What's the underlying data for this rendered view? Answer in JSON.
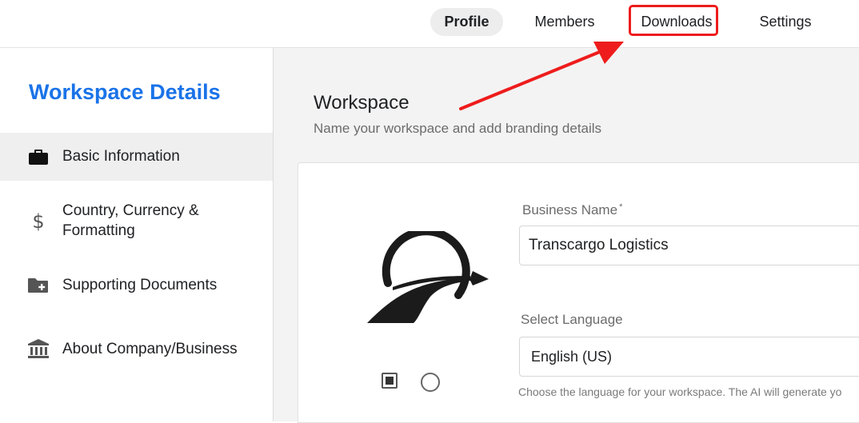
{
  "header": {
    "tabs": [
      {
        "label": "Profile",
        "active": true
      },
      {
        "label": "Members",
        "active": false
      },
      {
        "label": "Downloads",
        "active": false,
        "highlighted": true
      },
      {
        "label": "Settings",
        "active": false
      }
    ]
  },
  "annotation": {
    "color": "#ee1c1c",
    "target": "Downloads"
  },
  "sidebar": {
    "title": "Workspace Details",
    "items": [
      {
        "label": "Basic Information",
        "icon": "briefcase-icon",
        "active": true
      },
      {
        "label_line1": "Country, Currency &",
        "label_line2": "Formatting",
        "icon": "dollar-icon",
        "active": false
      },
      {
        "label": "Supporting Documents",
        "icon": "folder-plus-icon",
        "active": false
      },
      {
        "label": "About Company/Business",
        "icon": "bank-icon",
        "active": false
      }
    ]
  },
  "main": {
    "title": "Workspace",
    "subtitle": "Name your workspace and add branding details",
    "business_name": {
      "label": "Business Name",
      "required_mark": "*",
      "value": "Transcargo Logistics"
    },
    "language": {
      "label": "Select Language",
      "value": "English (US)",
      "helper": "Choose the language for your workspace. The AI will generate yo"
    }
  },
  "colors": {
    "accent": "#1a73e8",
    "highlight": "#ee1c1c",
    "main_bg": "#f3f3f3"
  }
}
